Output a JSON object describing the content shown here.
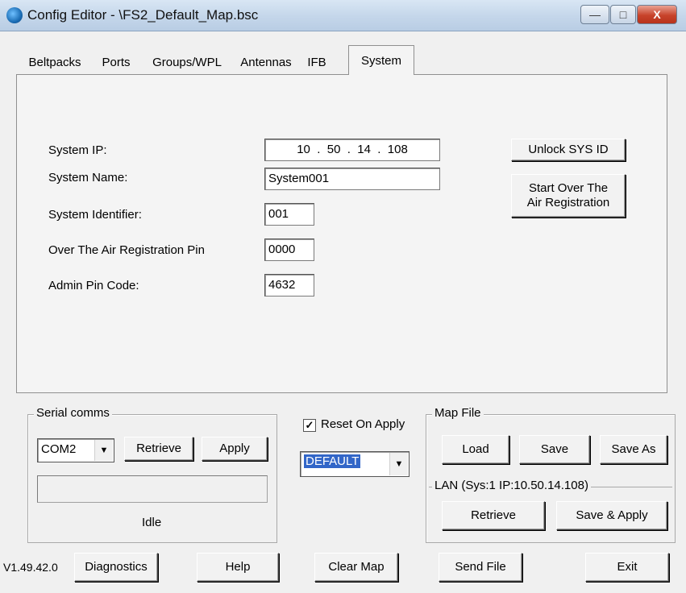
{
  "window": {
    "title": "Config Editor - \\FS2_Default_Map.bsc",
    "minimize": "—",
    "maximize": "□",
    "close": "X"
  },
  "tabs": [
    {
      "label": "Beltpacks"
    },
    {
      "label": "Ports"
    },
    {
      "label": "Groups/WPL"
    },
    {
      "label": "Antennas"
    },
    {
      "label": "IFB"
    },
    {
      "label": "System",
      "active": true
    }
  ],
  "system": {
    "ip_label": "System IP:",
    "ip_value": "10  .  50  .  14  .  108",
    "name_label": "System Name:",
    "name_value": "System001",
    "identifier_label": "System Identifier:",
    "identifier_value": "001",
    "ota_pin_label": "Over The Air Registration Pin",
    "ota_pin_value": "0000",
    "admin_pin_label": "Admin Pin Code:",
    "admin_pin_value": "4632",
    "unlock_button": "Unlock SYS ID",
    "start_over_button_line1": "Start Over The",
    "start_over_button_line2": "Air Registration"
  },
  "serial": {
    "group_title": "Serial comms",
    "port_value": "COM2",
    "retrieve_button": "Retrieve",
    "apply_button": "Apply",
    "status": "Idle"
  },
  "reset": {
    "checkbox_label": "Reset On Apply",
    "checked_mark": "✓",
    "profile_value": "DEFAULT"
  },
  "mapfile": {
    "group_title": "Map File",
    "load_button": "Load",
    "save_button": "Save",
    "save_as_button": "Save As",
    "lan_title": "LAN  (Sys:1 IP:10.50.14.108)",
    "retrieve_button": "Retrieve",
    "save_apply_button": "Save & Apply"
  },
  "footer": {
    "version": "V1.49.42.0",
    "diagnostics_button": "Diagnostics",
    "help_button": "Help",
    "clear_map_button": "Clear Map",
    "send_file_button": "Send File",
    "exit_button": "Exit"
  },
  "colors": {
    "selection": "#3266c8",
    "close_button": "#c7432b",
    "title_bar": "#c4d6ea"
  }
}
